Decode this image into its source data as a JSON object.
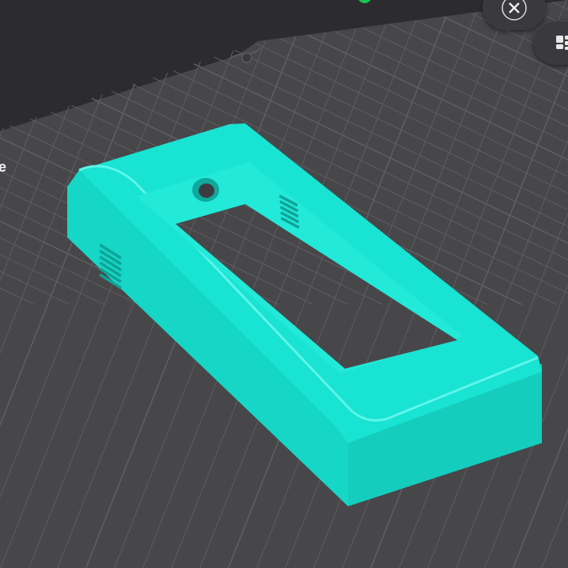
{
  "viewport": {
    "background_color": "#2c2c2f",
    "plate_color": "#47474a",
    "grid_line_color": "#5e5e62",
    "model_color": "#19e3d2",
    "accent_green": "#19c24a"
  },
  "left_edge_text": "e",
  "toolbar": {
    "close_icon": "close-icon",
    "arrange_icon": "arrange-icon"
  }
}
